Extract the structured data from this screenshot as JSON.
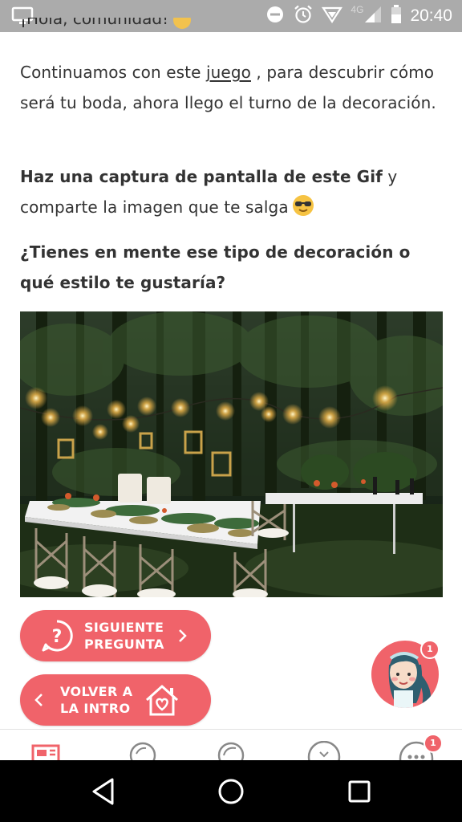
{
  "status_bar": {
    "time": "20:40",
    "network": "4G",
    "icons": [
      "screen-icon",
      "dnd-icon",
      "alarm-icon",
      "data-icon",
      "signal-icon",
      "battery-icon"
    ]
  },
  "post": {
    "cut_line": "¡Hola, comunidad!",
    "paragraph1_before": "Continuamos con este ",
    "paragraph1_link": "juego",
    "paragraph1_after": " , para descubrir cómo será tu boda, ahora llego el turno de la decoración.",
    "paragraph2_bold": "Haz una captura de pantalla de este Gif",
    "paragraph2_rest": " y comparte la imagen que te salga",
    "paragraph3": "¿Tienes en mente ese tipo de decoración o qué estilo te gustaría?"
  },
  "buttons": {
    "next_line1": "SIGUIENTE",
    "next_line2": "PREGUNTA",
    "back_line1": "VOLVER A",
    "back_line2": "LA INTRO"
  },
  "avatar": {
    "badge_count": "1"
  },
  "app_nav": {
    "items": [
      "news-icon",
      "magazine-icon",
      "community-icon",
      "heart-icon",
      "more-icon"
    ],
    "more_badge": "1"
  },
  "colors": {
    "accent": "#f0636a",
    "status_bar": "#ababab",
    "system_nav": "#000000"
  }
}
